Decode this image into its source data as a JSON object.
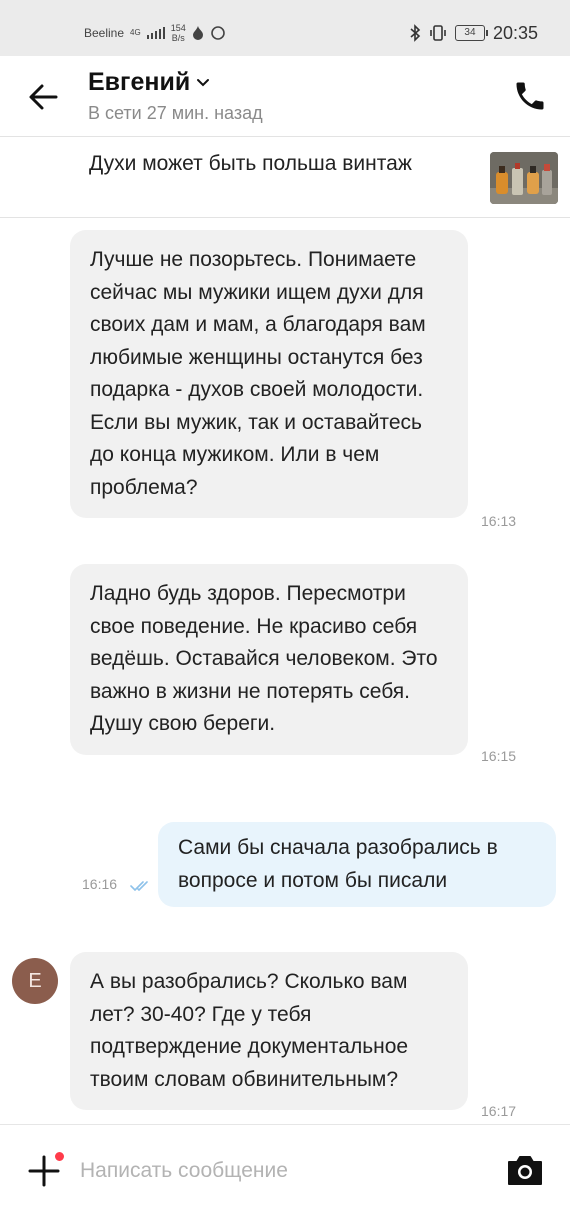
{
  "status_bar": {
    "carrier": "Beeline",
    "network": "4G",
    "speed_value": "154",
    "speed_unit": "B/s",
    "battery": "34",
    "time": "20:35"
  },
  "header": {
    "name": "Евгений",
    "status": "В сети 27 мин. назад"
  },
  "listing": {
    "title": "Духи может быть польша винтаж"
  },
  "messages": [
    {
      "direction": "in",
      "text": "Лучше не позорьтесь. Понимаете сейчас мы мужики ищем духи для своих дам и мам, а благодаря вам любимые женщины останутся без подарка - духов своей молодости. Если вы мужик, так и оставайтесь до конца мужиком. Или в чем проблема?",
      "time": "16:13"
    },
    {
      "direction": "in",
      "text": "Ладно будь здоров. Пересмотри свое поведение. Не красиво себя ведёшь. Оставайся человеком. Это важно в жизни не потерять себя. Душу свою береги.",
      "time": "16:15"
    },
    {
      "direction": "out",
      "text": "Сами бы сначала разобрались в вопросе и потом бы писали",
      "time": "16:16",
      "read": true
    },
    {
      "direction": "in",
      "avatar": "Е",
      "text": "А вы разобрались? Сколько вам лет? 30-40? Где у тебя подтверждение документальное твоим словам обвинительным?",
      "time": "16:17"
    }
  ],
  "composer": {
    "placeholder": "Написать сообщение"
  },
  "colors": {
    "incoming_bubble": "#f1f1f1",
    "outgoing_bubble": "#e8f4fc",
    "read_check": "#8ec2ea",
    "notification_dot": "#ff3b4a",
    "avatar_bg": "#8b5d4d"
  },
  "icons": {
    "back": "arrow-left-icon",
    "name_menu": "chevron-down-icon",
    "call": "phone-icon",
    "attach": "plus-icon",
    "camera": "camera-icon",
    "read": "double-check-icon"
  }
}
